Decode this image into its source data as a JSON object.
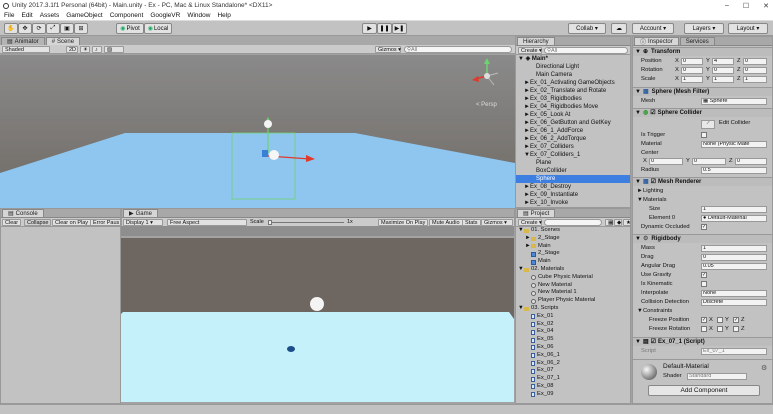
{
  "window": {
    "title": "Unity 2017.3.1f1 Personal (64bit) - Main.unity - Ex - PC, Mac & Linux Standalone* <DX11>",
    "minimize": "–",
    "maximize": "☐",
    "close": "✕"
  },
  "menu": [
    "File",
    "Edit",
    "Assets",
    "GameObject",
    "Component",
    "GoogleVR",
    "Window",
    "Help"
  ],
  "toolbar": {
    "pivot": "Pivot",
    "local": "Local",
    "collab": "Collab ▾",
    "account": "Account ▾",
    "layers": "Layers ▾",
    "layout": "Layout ▾",
    "play": "▶",
    "pause": "❚❚",
    "step": "▶❚"
  },
  "scene_panel": {
    "tabs": [
      "Animator",
      "Scene"
    ],
    "shaded": "Shaded",
    "mode_2d": "2D",
    "gizmos": "Gizmos ▾",
    "search_placeholder": "⚲All",
    "persp": "< Persp"
  },
  "hierarchy": {
    "tab": "Hierarchy",
    "create": "Create ▾",
    "search_placeholder": "⚲All",
    "scene": "Main*",
    "items": [
      {
        "label": "Directional Light",
        "indent": 2,
        "arrow": ""
      },
      {
        "label": "Main Camera",
        "indent": 2,
        "arrow": ""
      },
      {
        "label": "Ex_01_Activating GameObjects",
        "indent": 1,
        "arrow": "►"
      },
      {
        "label": "Ex_02_Translate and Rotate",
        "indent": 1,
        "arrow": "►"
      },
      {
        "label": "Ex_03_Rigidbodies",
        "indent": 1,
        "arrow": "►"
      },
      {
        "label": "Ex_04_Rigidbodies Move",
        "indent": 1,
        "arrow": "►"
      },
      {
        "label": "Ex_05_Look At",
        "indent": 1,
        "arrow": "►"
      },
      {
        "label": "Ex_06_GetButton and GetKey",
        "indent": 1,
        "arrow": "►"
      },
      {
        "label": "Ex_06_1_AddForce",
        "indent": 1,
        "arrow": "►"
      },
      {
        "label": "Ex_06_2_AddTorque",
        "indent": 1,
        "arrow": "►"
      },
      {
        "label": "Ex_07_Colliders",
        "indent": 1,
        "arrow": "►"
      },
      {
        "label": "Ex_07_Colliders_1",
        "indent": 1,
        "arrow": "▼"
      },
      {
        "label": "Plane",
        "indent": 2,
        "arrow": ""
      },
      {
        "label": "BoxCollider",
        "indent": 2,
        "arrow": ""
      },
      {
        "label": "Sphere",
        "indent": 2,
        "arrow": "",
        "selected": true
      },
      {
        "label": "Ex_08_Destroy",
        "indent": 1,
        "arrow": "►"
      },
      {
        "label": "Ex_09_Instantiate",
        "indent": 1,
        "arrow": "►"
      },
      {
        "label": "Ex_10_Invoke",
        "indent": 1,
        "arrow": "►"
      }
    ]
  },
  "project": {
    "tab": "Project",
    "create": "Create ▾",
    "items": [
      {
        "label": "01. Scenes",
        "indent": 0,
        "arrow": "▼",
        "icon": "folder"
      },
      {
        "label": "2_Stage",
        "indent": 1,
        "arrow": "►",
        "icon": "folder"
      },
      {
        "label": "Main",
        "indent": 1,
        "arrow": "►",
        "icon": "folder"
      },
      {
        "label": "2_Stage",
        "indent": 1,
        "arrow": "",
        "icon": "unity"
      },
      {
        "label": "Main",
        "indent": 1,
        "arrow": "",
        "icon": "unity"
      },
      {
        "label": "02. Materials",
        "indent": 0,
        "arrow": "▼",
        "icon": "folder"
      },
      {
        "label": "Cube Physic Material",
        "indent": 1,
        "arrow": "",
        "icon": "physic"
      },
      {
        "label": "New Material",
        "indent": 1,
        "arrow": "",
        "icon": "material"
      },
      {
        "label": "New Material 1",
        "indent": 1,
        "arrow": "",
        "icon": "material"
      },
      {
        "label": "Player Physic Material",
        "indent": 1,
        "arrow": "",
        "icon": "physic"
      },
      {
        "label": "03. Scripts",
        "indent": 0,
        "arrow": "▼",
        "icon": "folder"
      },
      {
        "label": "Ex_01",
        "indent": 1,
        "arrow": "",
        "icon": "script"
      },
      {
        "label": "Ex_02",
        "indent": 1,
        "arrow": "",
        "icon": "script"
      },
      {
        "label": "Ex_04",
        "indent": 1,
        "arrow": "",
        "icon": "script"
      },
      {
        "label": "Ex_05",
        "indent": 1,
        "arrow": "",
        "icon": "script"
      },
      {
        "label": "Ex_06",
        "indent": 1,
        "arrow": "",
        "icon": "script"
      },
      {
        "label": "Ex_06_1",
        "indent": 1,
        "arrow": "",
        "icon": "script"
      },
      {
        "label": "Ex_06_2",
        "indent": 1,
        "arrow": "",
        "icon": "script"
      },
      {
        "label": "Ex_07",
        "indent": 1,
        "arrow": "",
        "icon": "script"
      },
      {
        "label": "Ex_07_1",
        "indent": 1,
        "arrow": "",
        "icon": "script"
      },
      {
        "label": "Ex_08",
        "indent": 1,
        "arrow": "",
        "icon": "script"
      },
      {
        "label": "Ex_09",
        "indent": 1,
        "arrow": "",
        "icon": "script"
      }
    ]
  },
  "console": {
    "tab": "Console",
    "buttons": [
      "Clear",
      "Collapse",
      "Clear on Play",
      "Error Paus"
    ]
  },
  "game": {
    "tab": "Game",
    "display": "Display 1 ▾",
    "aspect": "Free Aspect",
    "scale_label": "Scale",
    "scale_value": "1x",
    "maximize": "Maximize On Play",
    "mute": "Mute Audio",
    "stats": "Stats",
    "gizmos": "Gizmos ▾"
  },
  "inspector": {
    "tabs": [
      "Inspector",
      "Services"
    ],
    "transform": {
      "title": "Transform",
      "position_label": "Position",
      "position": [
        "0",
        "4",
        "0"
      ],
      "rotation_label": "Rotation",
      "rotation": [
        "0",
        "0",
        "0"
      ],
      "scale_label": "Scale",
      "scale": [
        "1",
        "1",
        "1"
      ],
      "axes": [
        "X",
        "Y",
        "Z"
      ]
    },
    "mesh_filter": {
      "title": "Sphere (Mesh Filter)",
      "mesh_label": "Mesh",
      "mesh": "Sphere"
    },
    "sphere_collider": {
      "title": "Sphere Collider",
      "edit": "Edit Collider",
      "trigger_label": "Is Trigger",
      "material_label": "Material",
      "material": "None (Physic Mate",
      "center_label": "Center",
      "center": [
        "0",
        "0",
        "0"
      ],
      "radius_label": "Radius",
      "radius": "0.5"
    },
    "mesh_renderer": {
      "title": "Mesh Renderer",
      "lighting": "Lighting",
      "materials": "Materials",
      "size_label": "Size",
      "size": "1",
      "element_label": "Element 0",
      "element": "Default-Material",
      "occluded_label": "Dynamic Occluded",
      "occluded_check": "✓"
    },
    "rigidbody": {
      "title": "Rigidbody",
      "mass_label": "Mass",
      "mass": "1",
      "drag_label": "Drag",
      "drag": "0",
      "angular_label": "Angular Drag",
      "angular": "0.05",
      "gravity_label": "Use Gravity",
      "gravity_check": "✓",
      "kinematic_label": "Is Kinematic",
      "interpolate_label": "Interpolate",
      "interpolate": "None",
      "collision_label": "Collision Detection",
      "collision": "Discrete",
      "constraints": "Constraints",
      "freeze_pos_label": "Freeze Position",
      "freeze_rot_label": "Freeze Rotation",
      "freeze_check": "✓"
    },
    "script": {
      "title": "Ex_07_1 (Script)",
      "script_label": "Script",
      "script": "Ex_07_1"
    },
    "material": {
      "name": "Default-Material",
      "shader_label": "Shader",
      "shader": "Standard"
    },
    "add_component": "Add Component"
  },
  "colors": {
    "selection": "#3d7fe0",
    "panel": "#c2c2c2",
    "plane_scene": "#8fc6ef",
    "plane_game": "#c5f1fb"
  }
}
